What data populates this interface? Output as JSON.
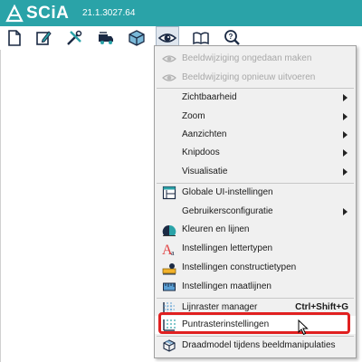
{
  "app": {
    "logo": "SCiA",
    "version": "21.1.3027.64",
    "brand_color": "#2aa3a8"
  },
  "toolbar": {
    "buttons": [
      {
        "icon": "new-document-icon"
      },
      {
        "icon": "edit-icon"
      },
      {
        "icon": "tools-icon"
      },
      {
        "icon": "truck-icon"
      },
      {
        "icon": "box-3d-icon"
      },
      {
        "icon": "eye-icon",
        "active": true
      },
      {
        "icon": "book-icon"
      },
      {
        "icon": "help-search-icon"
      }
    ]
  },
  "menu": {
    "items": [
      {
        "label": "Beeldwijziging ongedaan maken",
        "disabled": true,
        "icon": "undo-view-icon"
      },
      {
        "label": "Beeldwijziging opnieuw uitvoeren",
        "disabled": true,
        "icon": "redo-view-icon"
      },
      {
        "label": "Zichtbaarheid",
        "submenu": true
      },
      {
        "label": "Zoom",
        "submenu": true
      },
      {
        "label": "Aanzichten",
        "submenu": true
      },
      {
        "label": "Knipdoos",
        "submenu": true
      },
      {
        "label": "Visualisatie",
        "submenu": true
      },
      {
        "label": "Globale UI-instellingen",
        "icon": "global-ui-icon"
      },
      {
        "label": "Gebruikersconfiguratie",
        "submenu": true
      },
      {
        "label": "Kleuren en lijnen",
        "icon": "colors-lines-icon"
      },
      {
        "label": "Instellingen lettertypen",
        "icon": "font-settings-icon"
      },
      {
        "label": "Instellingen constructietypen",
        "icon": "construction-types-icon"
      },
      {
        "label": "Instellingen maatlijnen",
        "icon": "dimension-lines-icon"
      },
      {
        "label": "Lijnraster manager",
        "shortcut": "Ctrl+Shift+G",
        "icon": "line-grid-icon"
      },
      {
        "label": "Puntrasterinstellingen",
        "icon": "point-grid-icon",
        "highlighted": true
      },
      {
        "label": "Draadmodel tijdens beeldmanipulaties",
        "icon": "wireframe-icon"
      }
    ]
  },
  "highlight_color": "#e02020"
}
